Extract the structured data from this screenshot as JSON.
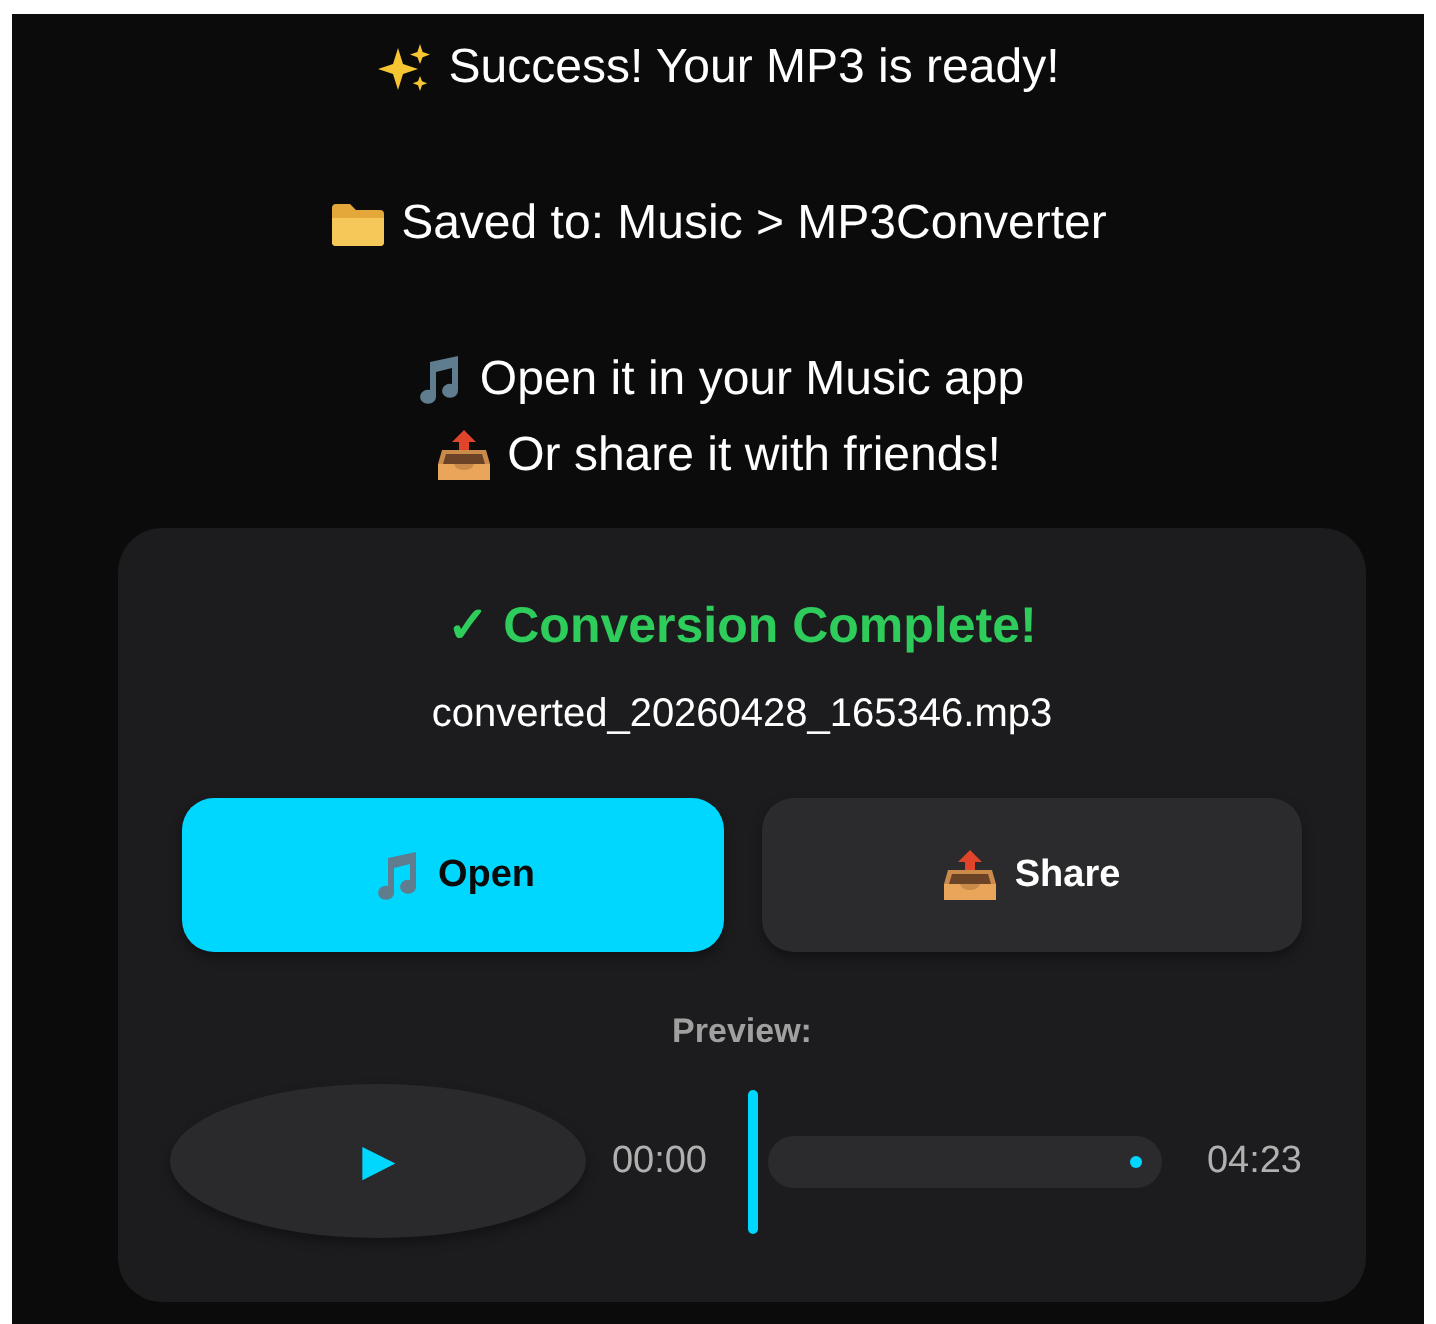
{
  "messages": [
    {
      "text": "Success! Your MP3 is ready!"
    },
    {
      "text": "Saved to: Music > MP3Converter"
    },
    {
      "text": "Open it in your Music app"
    },
    {
      "text": "Or share it with friends!"
    }
  ],
  "card": {
    "title": "✓ Conversion Complete!",
    "filename": "converted_20260428_165346.mp3",
    "buttons": [
      {
        "label": "Open",
        "kind": "primary"
      },
      {
        "label": "Share",
        "kind": "secondary"
      }
    ],
    "preview": {
      "label": "Preview:",
      "play": "▶",
      "elapsed": "00:00",
      "duration": "04:23",
      "level": 0
    }
  }
}
